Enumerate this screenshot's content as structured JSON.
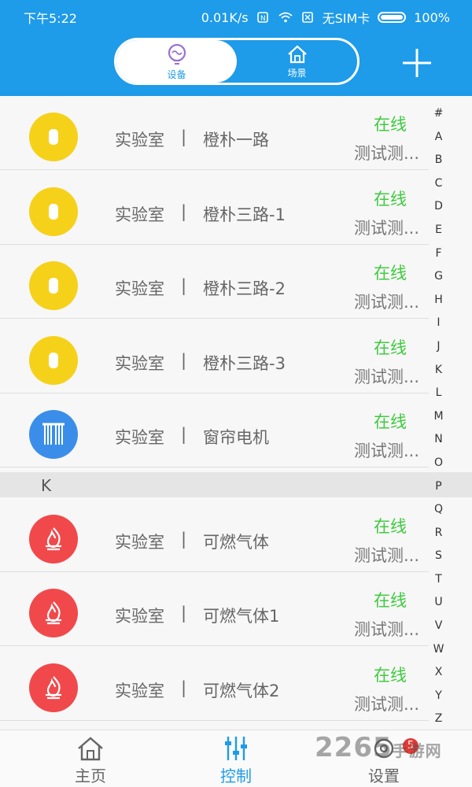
{
  "statusbar": {
    "time": "下午5:22",
    "speed": "0.01K/s",
    "sim": "无SIM卡",
    "battery": "100%"
  },
  "header": {
    "tab_devices": "设备",
    "tab_scenes": "场景"
  },
  "section_k": "K",
  "rows": [
    {
      "room": "实验室",
      "sep": "|",
      "name": "橙朴一路",
      "status": "在线",
      "desc": "测试测...",
      "icon": "switch-icon",
      "color": "#f6d11a"
    },
    {
      "room": "实验室",
      "sep": "|",
      "name": "橙朴三路-1",
      "status": "在线",
      "desc": "测试测...",
      "icon": "switch-icon",
      "color": "#f6d11a"
    },
    {
      "room": "实验室",
      "sep": "|",
      "name": "橙朴三路-2",
      "status": "在线",
      "desc": "测试测...",
      "icon": "switch-icon",
      "color": "#f6d11a"
    },
    {
      "room": "实验室",
      "sep": "|",
      "name": "橙朴三路-3",
      "status": "在线",
      "desc": "测试测...",
      "icon": "switch-icon",
      "color": "#f6d11a"
    },
    {
      "room": "实验室",
      "sep": "|",
      "name": "窗帘电机",
      "status": "在线",
      "desc": "测试测...",
      "icon": "curtain-icon",
      "color": "#3a8ee9"
    },
    {
      "room": "实验室",
      "sep": "|",
      "name": "可燃气体",
      "status": "在线",
      "desc": "测试测...",
      "icon": "gas-flame-icon",
      "color": "#f1494b"
    },
    {
      "room": "实验室",
      "sep": "|",
      "name": "可燃气体1",
      "status": "在线",
      "desc": "测试测...",
      "icon": "gas-flame-icon",
      "color": "#f1494b"
    },
    {
      "room": "实验室",
      "sep": "|",
      "name": "可燃气体2",
      "status": "在线",
      "desc": "测试测...",
      "icon": "gas-flame-icon",
      "color": "#f1494b"
    }
  ],
  "alphabet": [
    "#",
    "A",
    "B",
    "C",
    "D",
    "E",
    "F",
    "G",
    "H",
    "I",
    "J",
    "K",
    "L",
    "M",
    "N",
    "O",
    "P",
    "Q",
    "R",
    "S",
    "T",
    "U",
    "V",
    "W",
    "X",
    "Y",
    "Z"
  ],
  "bottomnav": {
    "home": "主页",
    "control": "控制",
    "settings": "设置",
    "badge": "5"
  },
  "watermark": {
    "main": "2265",
    "sub": "手游网"
  },
  "colors": {
    "accent": "#1e9be9",
    "online": "#3fcb3f"
  }
}
